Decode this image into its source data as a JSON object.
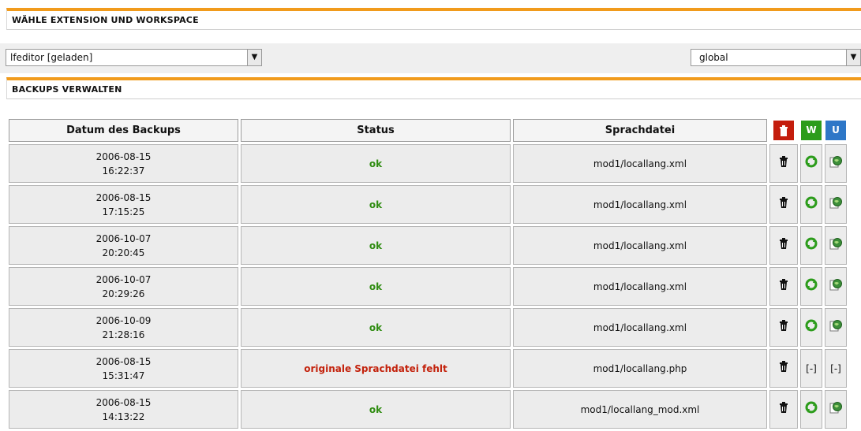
{
  "section1": {
    "title": "WÄHLE EXTENSION UND WORKSPACE"
  },
  "extension_select": {
    "value": "lfeditor [geladen]"
  },
  "workspace_select": {
    "value": "global"
  },
  "section2": {
    "title": "BACKUPS VERWALTEN"
  },
  "table": {
    "headers": {
      "date": "Datum des Backups",
      "status": "Status",
      "file": "Sprachdatei",
      "w": "W",
      "u": "U"
    },
    "rows": [
      {
        "date": "2006-08-15",
        "time": "16:22:37",
        "status": "ok",
        "status_type": "ok",
        "file": "mod1/locallang.xml",
        "w": "icon",
        "u": "icon"
      },
      {
        "date": "2006-08-15",
        "time": "17:15:25",
        "status": "ok",
        "status_type": "ok",
        "file": "mod1/locallang.xml",
        "w": "icon",
        "u": "icon"
      },
      {
        "date": "2006-10-07",
        "time": "20:20:45",
        "status": "ok",
        "status_type": "ok",
        "file": "mod1/locallang.xml",
        "w": "icon",
        "u": "icon"
      },
      {
        "date": "2006-10-07",
        "time": "20:29:26",
        "status": "ok",
        "status_type": "ok",
        "file": "mod1/locallang.xml",
        "w": "icon",
        "u": "icon"
      },
      {
        "date": "2006-10-09",
        "time": "21:28:16",
        "status": "ok",
        "status_type": "ok",
        "file": "mod1/locallang.xml",
        "w": "icon",
        "u": "icon"
      },
      {
        "date": "2006-08-15",
        "time": "15:31:47",
        "status": "originale Sprachdatei fehlt",
        "status_type": "error",
        "file": "mod1/locallang.php",
        "w": "[-]",
        "u": "[-]"
      },
      {
        "date": "2006-08-15",
        "time": "14:13:22",
        "status": "ok",
        "status_type": "ok",
        "file": "mod1/locallang_mod.xml",
        "w": "icon",
        "u": "icon"
      }
    ]
  },
  "colors": {
    "accent": "#f19b1c",
    "delete": "#c41d0d",
    "write": "#2c9c1b",
    "update": "#2e77c7",
    "ok": "#2f8c11",
    "error": "#c3220c"
  }
}
